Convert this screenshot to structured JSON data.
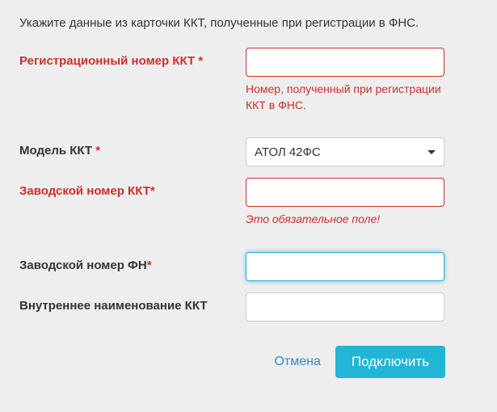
{
  "instruction": "Укажите данные из карточки ККТ, полученные при регистрации в ФНС.",
  "fields": {
    "reg_number": {
      "label": "Регистрационный номер ККТ",
      "required_mark": "*",
      "value": "",
      "help": "Номер, полученный при регистрации ККТ в ФНС."
    },
    "model": {
      "label": "Модель ККТ",
      "required_mark": "*",
      "selected": "АТОЛ 42ФС"
    },
    "factory_number_kkt": {
      "label": "Заводской номер ККТ",
      "required_mark": "*",
      "value": "",
      "help": "Это обязательное поле!"
    },
    "factory_number_fn": {
      "label": "Заводской номер ФН",
      "required_mark": "*",
      "value": ""
    },
    "internal_name": {
      "label": "Внутреннее наименование ККТ",
      "value": ""
    }
  },
  "actions": {
    "cancel": "Отмена",
    "submit": "Подключить"
  }
}
